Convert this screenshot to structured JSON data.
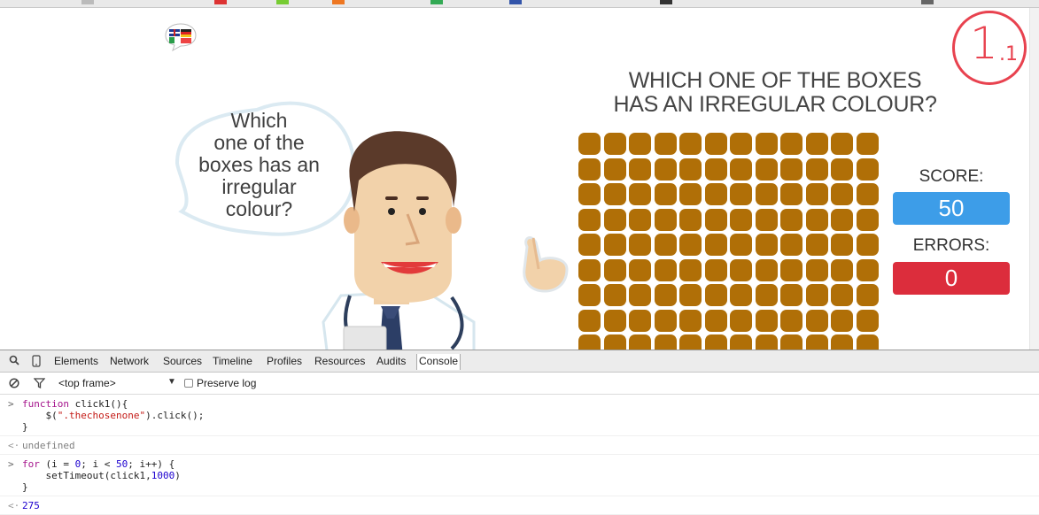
{
  "game": {
    "level_main": "1",
    "level_sub": ".1",
    "question_title": [
      "WHICH ONE OF THE BOXES",
      "HAS AN IRREGULAR COLOUR?"
    ],
    "speech_bubble": [
      "Which",
      "one of the",
      "boxes has an",
      "irregular",
      "colour?"
    ],
    "score_label": "SCORE:",
    "score_value": "50",
    "errors_label": "ERRORS:",
    "errors_value": "0",
    "grid": {
      "columns": 12,
      "visible_rows": 9,
      "box_color": "#b06f07"
    },
    "colors": {
      "accent_red": "#e8424f",
      "score_blue": "#3d9de8",
      "errors_red": "#dc2d3c"
    }
  },
  "devtools": {
    "tabs": [
      "Elements",
      "Network",
      "Sources",
      "Timeline",
      "Profiles",
      "Resources",
      "Audits",
      "Console"
    ],
    "active_tab": "Console",
    "toolbar": {
      "frame_select": "<top frame>",
      "preserve_log_label": "Preserve log"
    },
    "console": {
      "entry1": {
        "line1_kw": "function",
        "line1_rest": " click1(){",
        "line2_pre": "    $(",
        "line2_str": "\".thechosenone\"",
        "line2_post": ").click();",
        "line3": "}"
      },
      "result1": "undefined",
      "entry2": {
        "line1_kw": "for",
        "line1_a": " (i = ",
        "line1_n1": "0",
        "line1_b": "; i < ",
        "line1_n2": "50",
        "line1_c": "; i++) {",
        "line2_pre": "    setTimeout(click1,",
        "line2_num": "1000",
        "line2_post": ")",
        "line3": "}"
      },
      "result2": "275"
    }
  }
}
